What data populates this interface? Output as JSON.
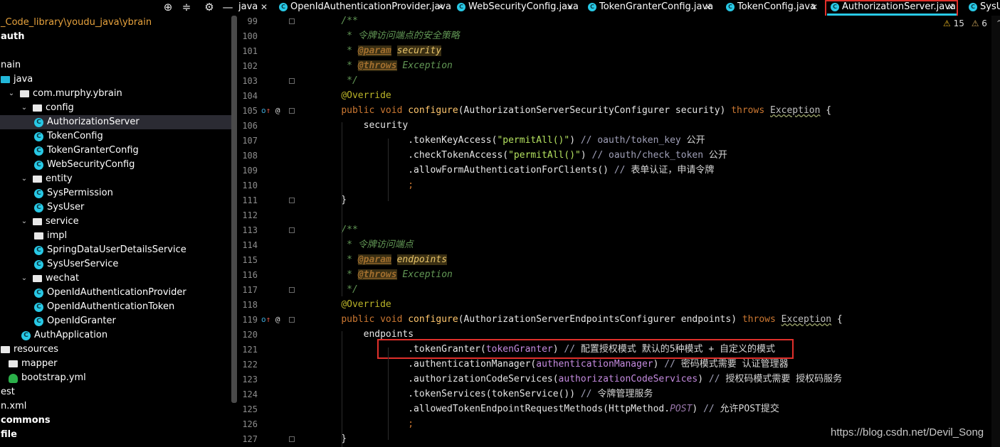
{
  "sidebar": {
    "toolbar_icons": [
      "crosshair-icon",
      "collapse-all-icon",
      "gear-icon",
      "minimize-icon"
    ],
    "tree": [
      {
        "label": "_Code_library\\youdu_java\\ybrain",
        "indent": 0,
        "style": "orange",
        "icon": ""
      },
      {
        "label": "auth",
        "indent": 0,
        "style": "bold",
        "icon": ""
      },
      {
        "label": "",
        "indent": 0,
        "icon": ""
      },
      {
        "label": "nain",
        "indent": 0,
        "icon": ""
      },
      {
        "label": "java",
        "indent": 0,
        "icon": "folder-blue"
      },
      {
        "label": "com.murphy.ybrain",
        "indent": 1,
        "icon": "folder",
        "arrow": "open"
      },
      {
        "label": "config",
        "indent": 2,
        "icon": "folder",
        "arrow": "open"
      },
      {
        "label": "AuthorizationServer",
        "indent": 3,
        "icon": "class",
        "selected": true
      },
      {
        "label": "TokenConfig",
        "indent": 3,
        "icon": "class"
      },
      {
        "label": "TokenGranterConfig",
        "indent": 3,
        "icon": "class"
      },
      {
        "label": "WebSecurityConfig",
        "indent": 3,
        "icon": "class"
      },
      {
        "label": "entity",
        "indent": 2,
        "icon": "folder",
        "arrow": "open"
      },
      {
        "label": "SysPermission",
        "indent": 3,
        "icon": "class"
      },
      {
        "label": "SysUser",
        "indent": 3,
        "icon": "class"
      },
      {
        "label": "service",
        "indent": 2,
        "icon": "folder",
        "arrow": "open"
      },
      {
        "label": "impl",
        "indent": 3,
        "icon": "folder"
      },
      {
        "label": "SpringDataUserDetailsService",
        "indent": 3,
        "icon": "class"
      },
      {
        "label": "SysUserService",
        "indent": 3,
        "icon": "class"
      },
      {
        "label": "wechat",
        "indent": 2,
        "icon": "folder",
        "arrow": "open"
      },
      {
        "label": "OpenIdAuthenticationProvider",
        "indent": 3,
        "icon": "class"
      },
      {
        "label": "OpenIdAuthenticationToken",
        "indent": 3,
        "icon": "class"
      },
      {
        "label": "OpenIdGranter",
        "indent": 3,
        "icon": "class"
      },
      {
        "label": "AuthApplication",
        "indent": 2,
        "icon": "class"
      },
      {
        "label": "resources",
        "indent": 0,
        "icon": "folder"
      },
      {
        "label": "mapper",
        "indent": 1,
        "icon": "folder"
      },
      {
        "label": "bootstrap.yml",
        "indent": 1,
        "icon": "yml"
      },
      {
        "label": "est",
        "indent": 0,
        "icon": ""
      },
      {
        "label": "n.xml",
        "indent": 0,
        "icon": ""
      },
      {
        "label": "commons",
        "indent": 0,
        "style": "bold",
        "icon": ""
      },
      {
        "label": "file",
        "indent": 0,
        "style": "bold",
        "icon": ""
      }
    ]
  },
  "tabs": [
    {
      "label": "java",
      "active": false
    },
    {
      "label": "OpenIdAuthenticationProvider.java",
      "active": false
    },
    {
      "label": "WebSecurityConfig.java",
      "active": false
    },
    {
      "label": "TokenGranterConfig.java",
      "active": false
    },
    {
      "label": "TokenConfig.java",
      "active": false
    },
    {
      "label": "AuthorizationServer.java",
      "active": true
    },
    {
      "label": "SysU",
      "active": false
    }
  ],
  "inspections": {
    "warnings": "15",
    "weak_warnings": "6"
  },
  "editor": {
    "lines": [
      {
        "n": "99",
        "tokens": [
          [
            "    ",
            ""
          ],
          [
            "/**",
            "doc"
          ]
        ]
      },
      {
        "n": "100",
        "tokens": [
          [
            "     ",
            ""
          ],
          [
            "* 令牌访问端点的安全策略",
            "doc"
          ]
        ]
      },
      {
        "n": "101",
        "tokens": [
          [
            "     ",
            ""
          ],
          [
            "* ",
            "doc"
          ],
          [
            "@param",
            "doctag"
          ],
          [
            " ",
            "doc"
          ],
          [
            "security",
            "docparam"
          ]
        ]
      },
      {
        "n": "102",
        "tokens": [
          [
            "     ",
            ""
          ],
          [
            "* ",
            "doc"
          ],
          [
            "@throws",
            "doctag"
          ],
          [
            " Exception",
            "doc"
          ]
        ]
      },
      {
        "n": "103",
        "tokens": [
          [
            "     ",
            ""
          ],
          [
            "*/",
            "doc"
          ]
        ]
      },
      {
        "n": "104",
        "tokens": [
          [
            "    ",
            ""
          ],
          [
            "@Override",
            "ann"
          ]
        ]
      },
      {
        "n": "105",
        "tokens": [
          [
            "    ",
            ""
          ],
          [
            "public void ",
            "kw"
          ],
          [
            "configure",
            "fn"
          ],
          [
            "(AuthorizationServerSecurityConfigurer security) ",
            ""
          ],
          [
            "throws ",
            "kw"
          ],
          [
            "Exception",
            "exc"
          ],
          [
            " {",
            ""
          ]
        ]
      },
      {
        "n": "106",
        "tokens": [
          [
            "        security",
            ""
          ]
        ]
      },
      {
        "n": "107",
        "tokens": [
          [
            "                .tokenKeyAccess(",
            ""
          ],
          [
            "\"permitAll()\"",
            "str2"
          ],
          [
            ") ",
            ""
          ],
          [
            "// oauth/token_key ",
            "cmt"
          ],
          [
            "公开",
            "cmtcn"
          ]
        ]
      },
      {
        "n": "108",
        "tokens": [
          [
            "                .checkTokenAccess(",
            ""
          ],
          [
            "\"permitAll()\"",
            "str2"
          ],
          [
            ") ",
            ""
          ],
          [
            "// oauth/check_token ",
            "cmt"
          ],
          [
            "公开",
            "cmtcn"
          ]
        ]
      },
      {
        "n": "109",
        "tokens": [
          [
            "                .allowFormAuthenticationForClients() ",
            ""
          ],
          [
            "// ",
            "cmt"
          ],
          [
            "表单认证，申请令牌",
            "cmtcn"
          ]
        ]
      },
      {
        "n": "110",
        "tokens": [
          [
            "                ",
            ""
          ],
          [
            ";",
            "kw"
          ]
        ]
      },
      {
        "n": "111",
        "tokens": [
          [
            "    }",
            ""
          ]
        ]
      },
      {
        "n": "112",
        "tokens": []
      },
      {
        "n": "113",
        "tokens": [
          [
            "    ",
            ""
          ],
          [
            "/**",
            "doc"
          ]
        ]
      },
      {
        "n": "114",
        "tokens": [
          [
            "     ",
            ""
          ],
          [
            "* 令牌访问端点",
            "doc"
          ]
        ]
      },
      {
        "n": "115",
        "tokens": [
          [
            "     ",
            ""
          ],
          [
            "* ",
            "doc"
          ],
          [
            "@param",
            "doctag"
          ],
          [
            " ",
            "doc"
          ],
          [
            "endpoints",
            "docparam"
          ]
        ]
      },
      {
        "n": "116",
        "tokens": [
          [
            "     ",
            ""
          ],
          [
            "* ",
            "doc"
          ],
          [
            "@throws",
            "doctag"
          ],
          [
            " Exception",
            "doc"
          ]
        ]
      },
      {
        "n": "117",
        "tokens": [
          [
            "     ",
            ""
          ],
          [
            "*/",
            "doc"
          ]
        ]
      },
      {
        "n": "118",
        "tokens": [
          [
            "    ",
            ""
          ],
          [
            "@Override",
            "ann"
          ]
        ]
      },
      {
        "n": "119",
        "tokens": [
          [
            "    ",
            ""
          ],
          [
            "public void ",
            "kw"
          ],
          [
            "configure",
            "fn"
          ],
          [
            "(AuthorizationServerEndpointsConfigurer endpoints) ",
            ""
          ],
          [
            "throws ",
            "kw"
          ],
          [
            "Exception",
            "exc"
          ],
          [
            " {",
            ""
          ]
        ]
      },
      {
        "n": "120",
        "tokens": [
          [
            "        endpoints",
            ""
          ]
        ]
      },
      {
        "n": "121",
        "tokens": [
          [
            "                .tokenGranter(",
            ""
          ],
          [
            "tokenGranter",
            "purple"
          ],
          [
            ") ",
            ""
          ],
          [
            "// ",
            "cmt"
          ],
          [
            "配置授权模式 默认的5种模式 + 自定义的模式",
            "cmtcn"
          ]
        ]
      },
      {
        "n": "122",
        "tokens": [
          [
            "                .authenticationManager(",
            ""
          ],
          [
            "authenticationManager",
            "purple"
          ],
          [
            ") ",
            ""
          ],
          [
            "// ",
            "cmt"
          ],
          [
            "密码模式需要 认证管理器",
            "cmtcn"
          ]
        ]
      },
      {
        "n": "123",
        "tokens": [
          [
            "                .authorizationCodeServices(",
            ""
          ],
          [
            "authorizationCodeServices",
            "purple"
          ],
          [
            ") ",
            ""
          ],
          [
            "// ",
            "cmt"
          ],
          [
            "授权码模式需要 授权码服务",
            "cmtcn"
          ]
        ]
      },
      {
        "n": "124",
        "tokens": [
          [
            "                .tokenServices(tokenService()) ",
            ""
          ],
          [
            "// ",
            "cmt"
          ],
          [
            "令牌管理服务",
            "cmtcn"
          ]
        ]
      },
      {
        "n": "125",
        "tokens": [
          [
            "                .allowedTokenEndpointRequestMethods(HttpMethod.",
            ""
          ],
          [
            "POST",
            "static"
          ],
          [
            ") ",
            ""
          ],
          [
            "// ",
            "cmt"
          ],
          [
            "允许POST提交",
            "cmtcn"
          ]
        ]
      },
      {
        "n": "126",
        "tokens": [
          [
            "                ",
            ""
          ],
          [
            ";",
            "kw"
          ]
        ]
      },
      {
        "n": "127",
        "tokens": [
          [
            "    }",
            ""
          ]
        ]
      }
    ]
  },
  "watermark": "https://blog.csdn.net/Devil_Song"
}
